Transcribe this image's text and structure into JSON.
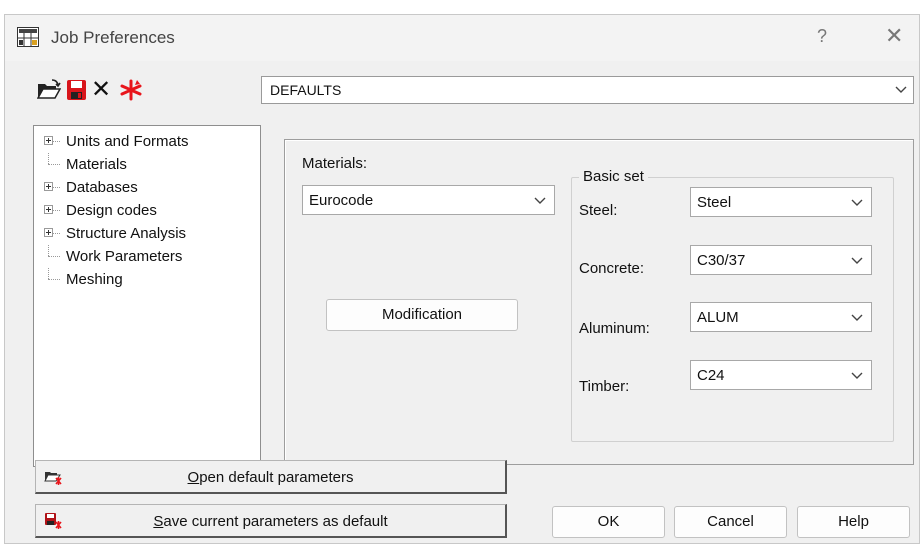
{
  "window": {
    "title": "Job Preferences",
    "help_glyph": "?",
    "close_glyph": "✕"
  },
  "toolbar": {
    "icons": [
      "open-folder-icon",
      "save-icon",
      "delete-icon",
      "reset-icon"
    ],
    "delete_glyph": "✕"
  },
  "defaults_combo": {
    "value": "DEFAULTS"
  },
  "tree": {
    "items": [
      {
        "label": "Units and Formats",
        "expandable": true
      },
      {
        "label": "Materials",
        "expandable": false
      },
      {
        "label": "Databases",
        "expandable": true
      },
      {
        "label": "Design codes",
        "expandable": true
      },
      {
        "label": "Structure Analysis",
        "expandable": true
      },
      {
        "label": "Work Parameters",
        "expandable": false
      },
      {
        "label": "Meshing",
        "expandable": false
      }
    ]
  },
  "materials": {
    "label": "Materials:",
    "value": "Eurocode",
    "modification_button": "Modification"
  },
  "basic_set": {
    "title": "Basic set",
    "rows": [
      {
        "label": "Steel:",
        "value": "Steel"
      },
      {
        "label": "Concrete:",
        "value": "C30/37"
      },
      {
        "label": "Aluminum:",
        "value": "ALUM"
      },
      {
        "label": "Timber:",
        "value": "C24"
      }
    ]
  },
  "buttons": {
    "open_default_first": "O",
    "open_default_rest": "pen default parameters",
    "save_default_first": "S",
    "save_default_rest": "ave current parameters as default",
    "ok": "OK",
    "cancel": "Cancel",
    "help": "Help"
  },
  "colors": {
    "window_bg": "#f0f0f0",
    "save_icon_red": "#d8151b",
    "reset_icon_red": "#e8151b"
  }
}
